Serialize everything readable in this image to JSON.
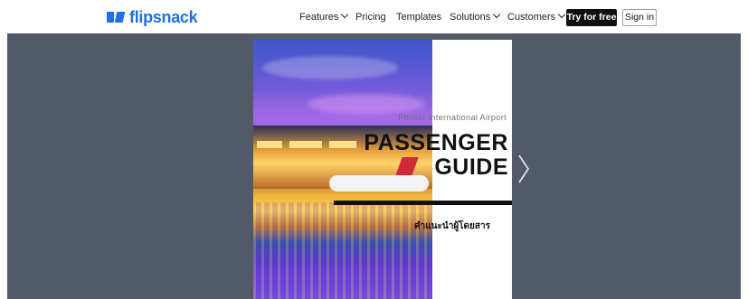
{
  "header": {
    "logo_text": "flipsnack",
    "brand_color": "#1f6fe5",
    "nav": [
      {
        "label": "Features",
        "has_dropdown": true
      },
      {
        "label": "Pricing",
        "has_dropdown": false
      },
      {
        "label": "Templates",
        "has_dropdown": false
      },
      {
        "label": "Solutions",
        "has_dropdown": true
      },
      {
        "label": "Customers",
        "has_dropdown": true
      }
    ],
    "cta_label": "Try for free",
    "signin_label": "Sign in"
  },
  "viewer": {
    "background": "#535a67",
    "cover": {
      "subtitle": "Phuket International Airport",
      "title_line1": "PASSENGER",
      "title_line2": "GUIDE",
      "thai_text": "คำแนะนำผู้โดยสาร"
    },
    "next_icon": "chevron-right-icon"
  }
}
